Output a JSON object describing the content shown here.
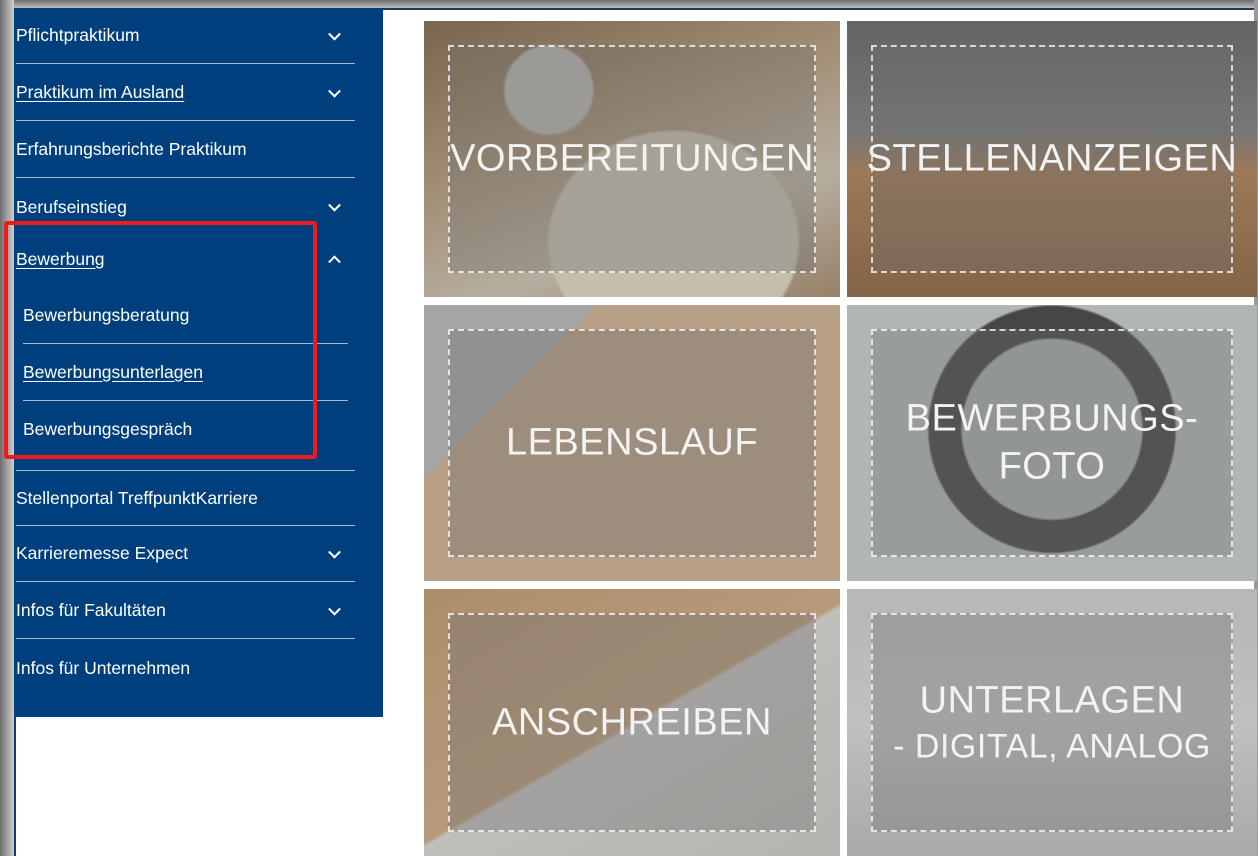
{
  "sidebar": {
    "items": [
      {
        "label": "Pflichtpraktikum",
        "has_children": true,
        "expanded": false,
        "underlined": false
      },
      {
        "label": "Praktikum im Ausland",
        "has_children": true,
        "expanded": false,
        "underlined": true
      },
      {
        "label": "Erfahrungsberichte Praktikum",
        "has_children": false,
        "underlined": false
      },
      {
        "label": "Berufseinstieg",
        "has_children": true,
        "expanded": false,
        "underlined": false
      },
      {
        "label": "Bewerbung",
        "has_children": true,
        "expanded": true,
        "underlined": true,
        "children": [
          {
            "label": "Bewerbungsberatung",
            "underlined": false
          },
          {
            "label": "Bewerbungsunterlagen",
            "underlined": true
          },
          {
            "label": "Bewerbungsgespräch",
            "underlined": false
          }
        ]
      },
      {
        "label": "Stellenportal TreffpunktKarriere",
        "has_children": false,
        "underlined": false
      },
      {
        "label": "Karrieremesse Expect",
        "has_children": true,
        "expanded": false,
        "underlined": false
      },
      {
        "label": "Infos für Fakultäten",
        "has_children": true,
        "expanded": false,
        "underlined": false
      },
      {
        "label": "Infos für Unternehmen",
        "has_children": false,
        "underlined": false
      }
    ]
  },
  "tiles": [
    {
      "title": "VORBEREITUNGEN",
      "subtitle": ""
    },
    {
      "title": "STELLENANZEIGEN",
      "subtitle": ""
    },
    {
      "title": "LEBENSLAUF",
      "subtitle": ""
    },
    {
      "title": "BEWERBUNGS-\nFOTO",
      "subtitle": ""
    },
    {
      "title": "ANSCHREIBEN",
      "subtitle": ""
    },
    {
      "title": "UNTERLAGEN",
      "subtitle": "- DIGITAL, ANALOG"
    }
  ],
  "colors": {
    "sidebar_bg": "#003f7d",
    "highlight": "#ee1c1c",
    "text_light": "#ffffff"
  }
}
